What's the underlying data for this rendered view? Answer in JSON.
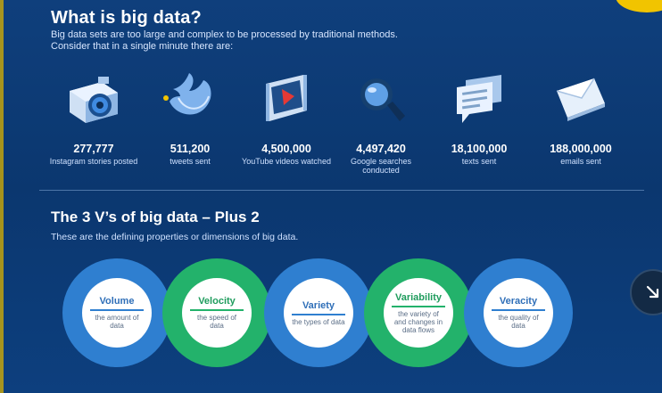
{
  "section1": {
    "title": "What is big data?",
    "subtitle_line1": "Big data sets are too large and complex to be processed by traditional methods.",
    "subtitle_line2": "Consider that in a single minute there are:"
  },
  "stats": [
    {
      "number": "277,777",
      "label": "Instagram stories posted",
      "icon": "camera-icon"
    },
    {
      "number": "511,200",
      "label": "tweets sent",
      "icon": "twitter-bird-icon"
    },
    {
      "number": "4,500,000",
      "label": "YouTube videos watched",
      "icon": "video-icon"
    },
    {
      "number": "4,497,420",
      "label": "Google searches conducted",
      "icon": "magnifier-icon"
    },
    {
      "number": "18,100,000",
      "label": "texts sent",
      "icon": "text-message-icon"
    },
    {
      "number": "188,000,000",
      "label": "emails sent",
      "icon": "envelope-icon"
    }
  ],
  "section2": {
    "title": "The 3 V’s of big data – Plus 2",
    "subtitle": "These are the defining properties or dimensions of big data."
  },
  "vs": [
    {
      "name": "Volume",
      "desc": "the amount of data",
      "color": "#2f7fd0"
    },
    {
      "name": "Velocity",
      "desc": "the speed of data",
      "color": "#23b26b"
    },
    {
      "name": "Variety",
      "desc": "the types of data",
      "color": "#2f7fd0"
    },
    {
      "name": "Variability",
      "desc": "the variety of and changes in data flows",
      "color": "#23b26b"
    },
    {
      "name": "Veracity",
      "desc": "the quality of data",
      "color": "#2f7fd0"
    }
  ],
  "colors": {
    "background": "#0b376f",
    "blue_ring": "#2f7fd0",
    "green_ring": "#23b26b",
    "accent_yellow": "#f1c400"
  }
}
